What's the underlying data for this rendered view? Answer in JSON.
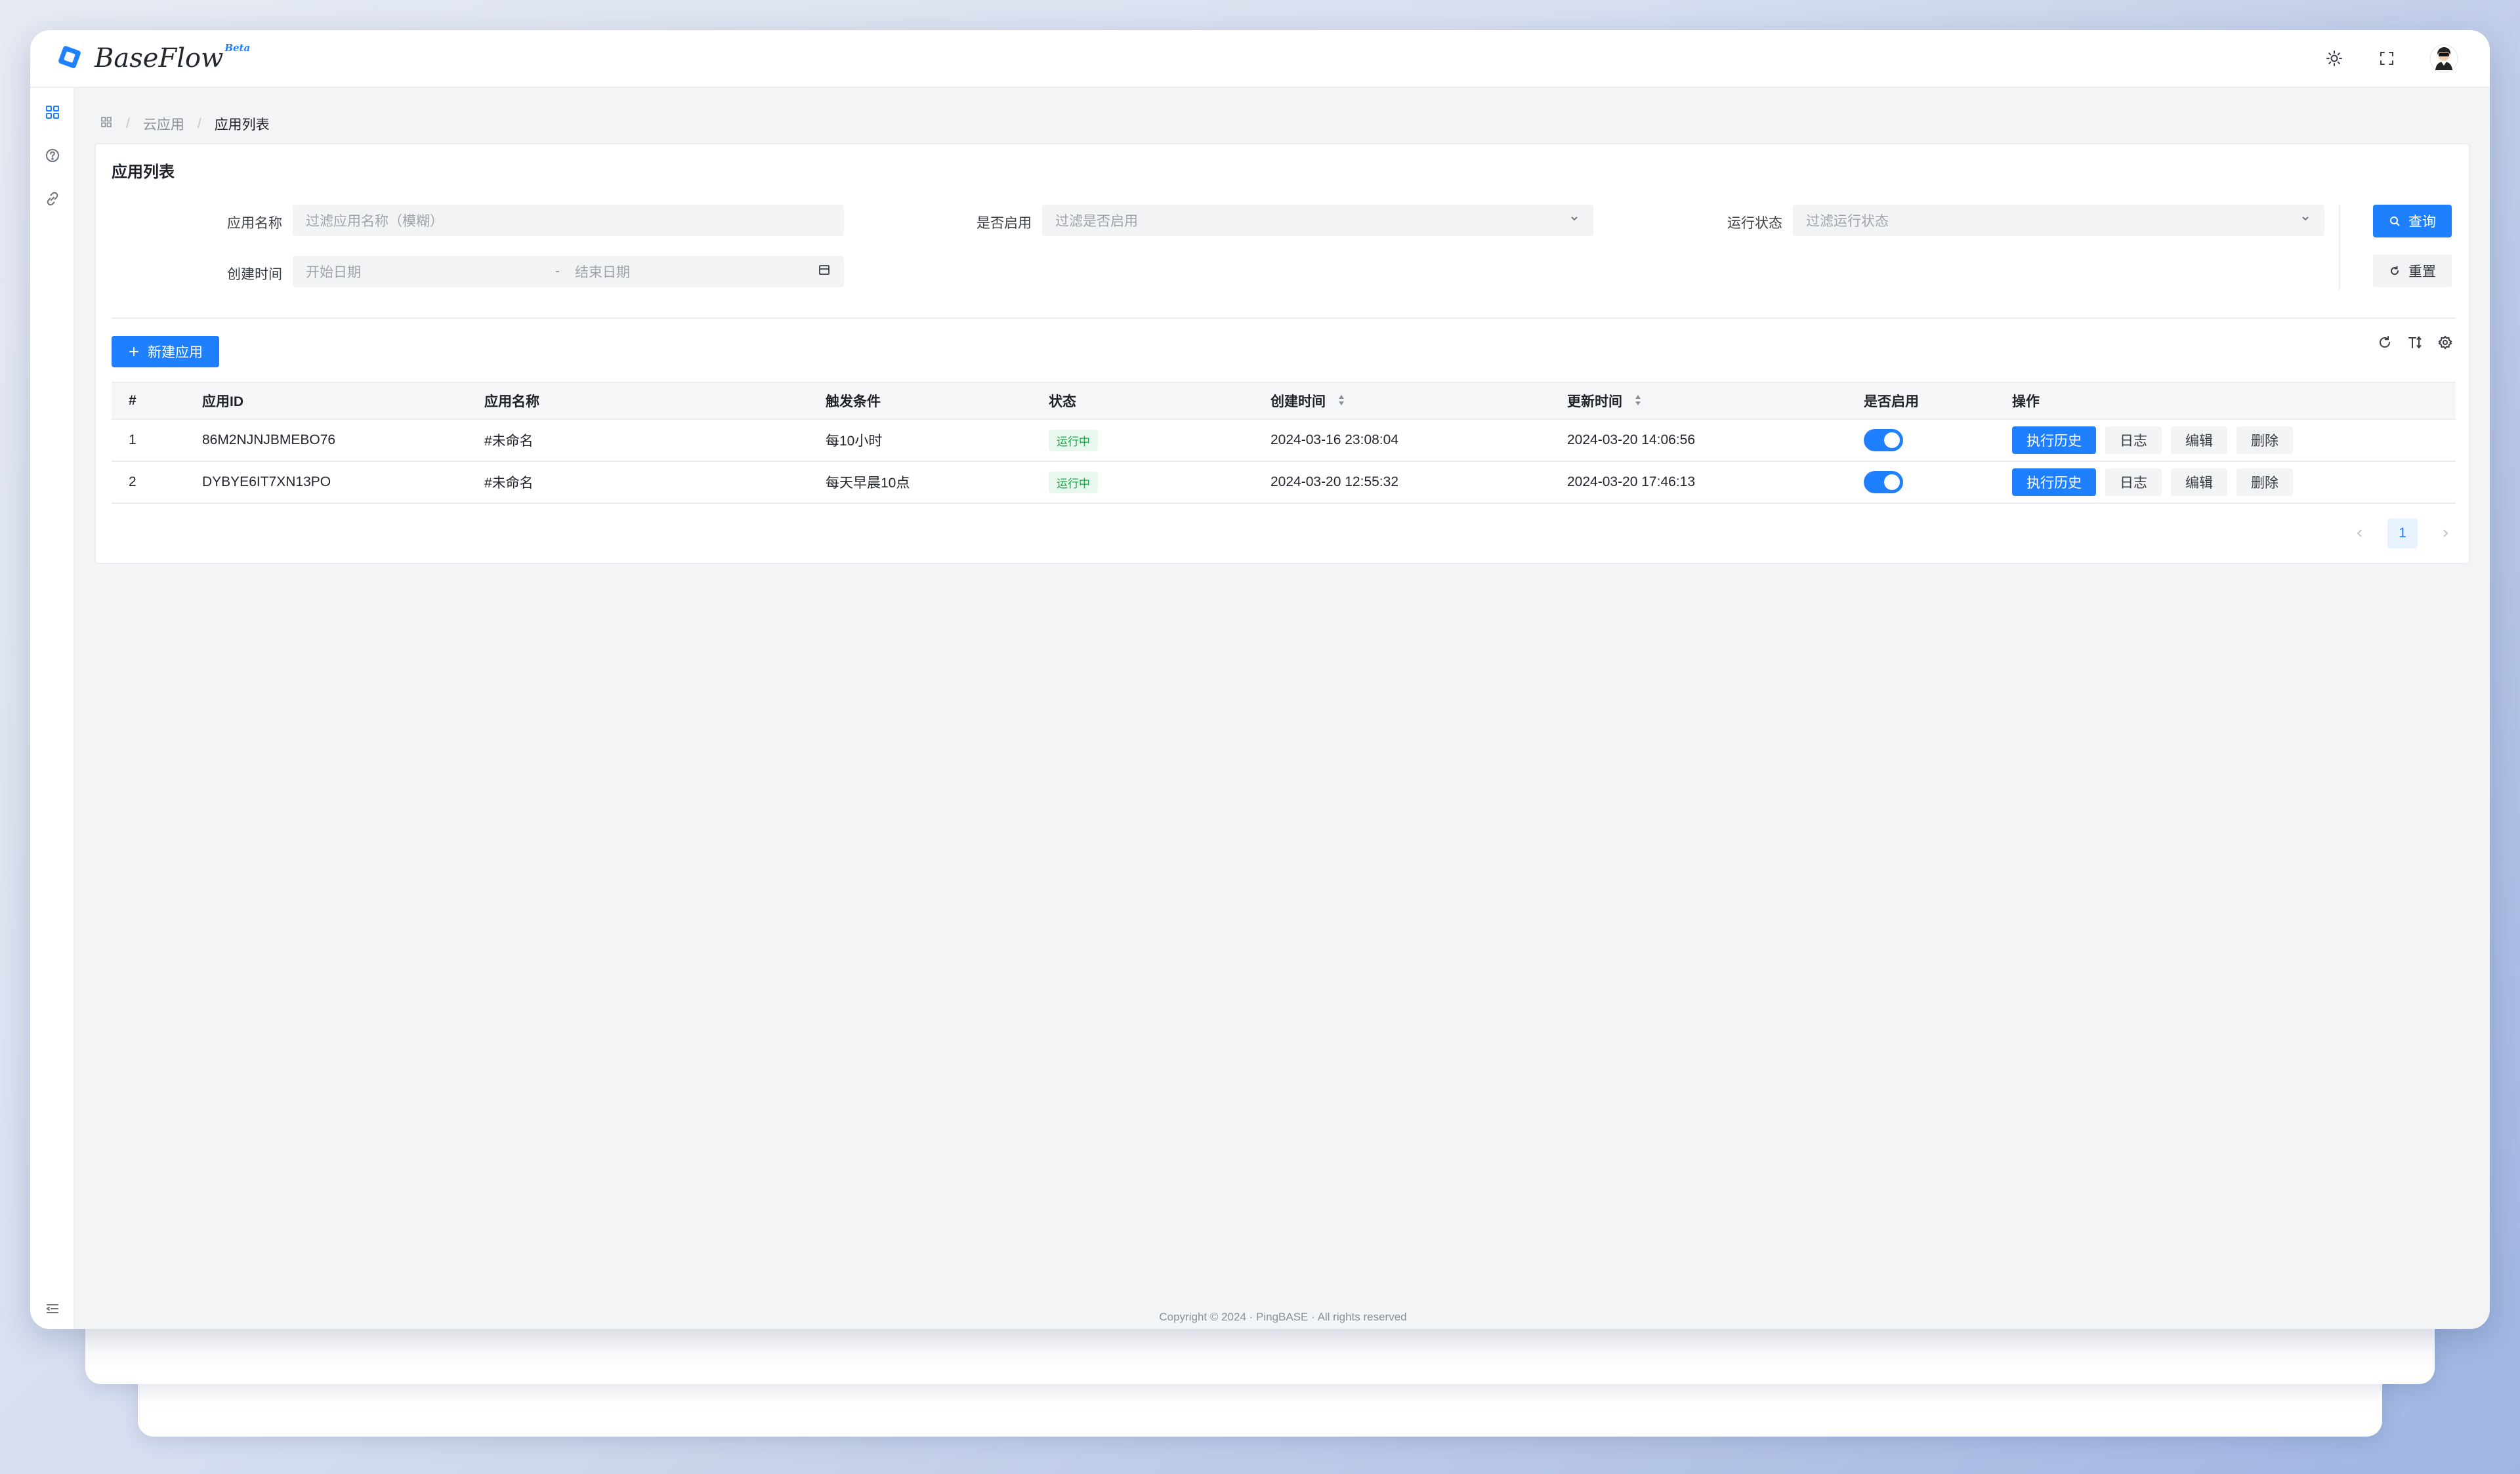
{
  "app": {
    "logo_name": "BaseFlow",
    "logo_badge": "Beta",
    "brand_color": "#1e80ff"
  },
  "header": {
    "icons": [
      "sun-icon",
      "fullscreen-icon",
      "user-avatar"
    ]
  },
  "sidebar": {
    "items": [
      "dashboard-icon",
      "help-circle-icon",
      "link-icon"
    ],
    "collapse_icon": "menu-collapse-icon"
  },
  "breadcrumb": {
    "items": [
      "云应用",
      "应用列表"
    ]
  },
  "panel": {
    "title": "应用列表"
  },
  "filters": {
    "name_label": "应用名称",
    "name_placeholder": "过滤应用名称（模糊）",
    "enabled_label": "是否启用",
    "enabled_placeholder": "过滤是否启用",
    "status_label": "运行状态",
    "status_placeholder": "过滤运行状态",
    "created_label": "创建时间",
    "start_placeholder": "开始日期",
    "range_sep": "-",
    "end_placeholder": "结束日期",
    "query_label": "查询",
    "reset_label": "重置"
  },
  "toolbar": {
    "new_label": "新建应用",
    "tools": [
      "refresh-icon",
      "density-icon",
      "settings-icon"
    ]
  },
  "table": {
    "columns": [
      "#",
      "应用ID",
      "应用名称",
      "触发条件",
      "状态",
      "创建时间",
      "更新时间",
      "是否启用",
      "操作"
    ],
    "rows": [
      {
        "index": "1",
        "id": "86M2NJNJBMEBO76",
        "name": "#未命名",
        "trigger": "每10小时",
        "status": "运行中",
        "created": "2024-03-16 23:08:04",
        "updated": "2024-03-20 14:06:56",
        "enabled": true
      },
      {
        "index": "2",
        "id": "DYBYE6IT7XN13PO",
        "name": "#未命名",
        "trigger": "每天早晨10点",
        "status": "运行中",
        "created": "2024-03-20 12:55:32",
        "updated": "2024-03-20 17:46:13",
        "enabled": true
      }
    ],
    "actions": {
      "history": "执行历史",
      "log": "日志",
      "edit": "编辑",
      "delete": "删除"
    }
  },
  "pagination": {
    "current": "1"
  },
  "footer": {
    "text": "Copyright © 2024 · PingBASE · All rights reserved"
  }
}
